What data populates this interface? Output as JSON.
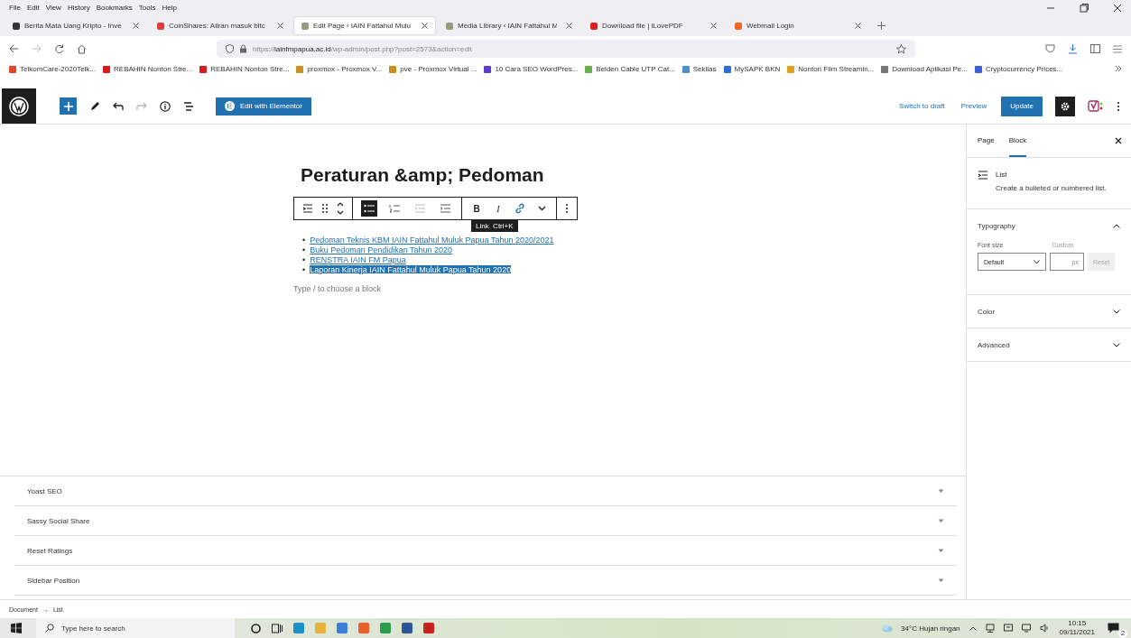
{
  "browser": {
    "menu": [
      "File",
      "Edit",
      "View",
      "History",
      "Bookmarks",
      "Tools",
      "Help"
    ],
    "tabs": [
      {
        "title": "Berita Mata Uang Kripto - Inve",
        "selected": false
      },
      {
        "title": "CoinShares: Aliran masuk bitc",
        "selected": false
      },
      {
        "title": "Edit Page ‹ IAIN Fattahul Mulu",
        "selected": true
      },
      {
        "title": "Media Library ‹ IAIN Fattahul M",
        "selected": false
      },
      {
        "title": "Download file | iLovePDF",
        "selected": false
      },
      {
        "title": "Webmail Login",
        "selected": false
      }
    ],
    "url": {
      "prefix": "https://",
      "domain": "iainfmpapua.ac.id",
      "path": "/wp-admin/post.php?post=2573&action=edit"
    },
    "bookmarks": [
      "TelkomCare-2020Telk...",
      "REBAHIN Nonton Stre...",
      "REBAHIN Nonton Stre...",
      "proxmox - Proxmox V...",
      "pve - Proxmox Virtual ...",
      "10 Cara SEO WordPres...",
      "Belden Cable UTP Cat...",
      "Sekilas",
      "MySAPK BKN",
      "Nonton Film Streamin...",
      "Download Aplikasi Pe...",
      "Cryptocurrency Prices..."
    ]
  },
  "editor_header": {
    "elementor_button": "Edit with Elementor",
    "switch_to_draft": "Switch to draft",
    "preview": "Preview",
    "update": "Update",
    "settings_pressed": true
  },
  "document": {
    "title": "Peraturan &amp; Pedoman",
    "block_toolbar": [
      {
        "kind": "bullets",
        "selected": true
      },
      {
        "kind": "numbers",
        "selected": false
      },
      {
        "kind": "outdent",
        "selected": false
      },
      {
        "kind": "indent",
        "selected": false
      }
    ],
    "format_buttons": [
      {
        "kind": "bold",
        "label": "B"
      },
      {
        "kind": "italic",
        "label": "I"
      },
      {
        "kind": "link"
      },
      {
        "kind": "more"
      }
    ],
    "tooltip": "Link  Ctrl+K",
    "list_items": [
      {
        "marker": "•",
        "text": "Pedoman Teknis KBM IAIN Fattahul Muluk Papua Tahun 2020/2021",
        "selected": false
      },
      {
        "marker": "•",
        "text": "Buku Pedoman Pendidikan Tahun 2020",
        "selected": false
      },
      {
        "marker": "•",
        "text": "RENSTRA IAIN FM Papua",
        "selected": false
      },
      {
        "marker": "•",
        "text": "Laporan Kinerja IAIN Fattahul Muluk Papua Tahun 2020",
        "selected": true
      }
    ],
    "placeholder": "Type / to choose a block"
  },
  "metaboxes": [
    {
      "title": "Yoast SEO",
      "expanded": false
    },
    {
      "title": "Sassy Social Share",
      "expanded": false
    },
    {
      "title": "Reset Ratings",
      "expanded": false
    },
    {
      "title": "Sidebar Position",
      "expanded": false
    }
  ],
  "sidebar": {
    "tabs": [
      {
        "label": "Page",
        "selected": false
      },
      {
        "label": "Block",
        "selected": true
      }
    ],
    "block_name": "List",
    "block_description": "Create a bulleted or numbered list.",
    "panels": [
      {
        "title": "Typography",
        "expanded": true
      },
      {
        "title": "Color",
        "expanded": false
      },
      {
        "title": "Advanced",
        "expanded": false
      }
    ],
    "font_size_label": "Font size",
    "custom_label": "Custom",
    "font_size_value": "Default",
    "unit": "px",
    "reset": "Reset"
  },
  "breadcrumb": [
    "Document",
    "→",
    "List"
  ],
  "taskbar": {
    "search_placeholder": "Type here to search",
    "weather": "34°C  Hujan ringan",
    "time": "10:15",
    "date": "09/11/2021",
    "notifications": "2"
  }
}
